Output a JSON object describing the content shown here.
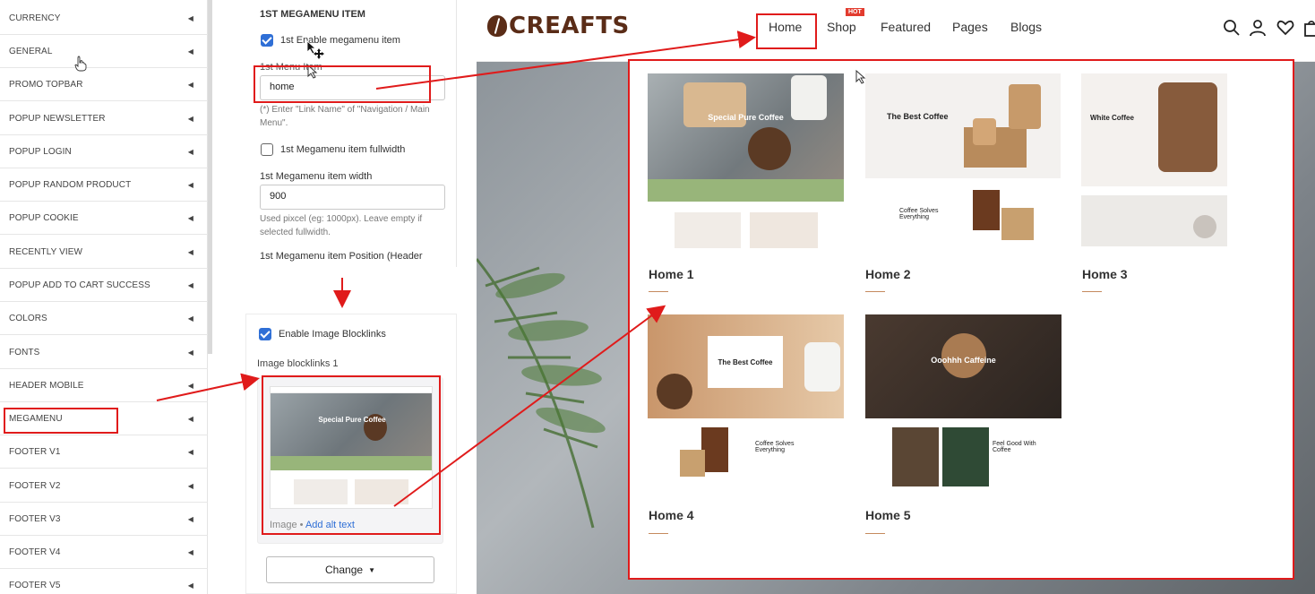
{
  "sidebar": {
    "items": [
      {
        "label": "CURRENCY"
      },
      {
        "label": "GENERAL"
      },
      {
        "label": "PROMO TOPBAR"
      },
      {
        "label": "POPUP NEWSLETTER"
      },
      {
        "label": "POPUP LOGIN"
      },
      {
        "label": "POPUP RANDOM PRODUCT"
      },
      {
        "label": "POPUP COOKIE"
      },
      {
        "label": "RECENTLY VIEW"
      },
      {
        "label": "POPUP ADD TO CART SUCCESS"
      },
      {
        "label": "COLORS"
      },
      {
        "label": "FONTS"
      },
      {
        "label": "HEADER MOBILE"
      },
      {
        "label": "MEGAMENU"
      },
      {
        "label": "FOOTER V1"
      },
      {
        "label": "FOOTER V2"
      },
      {
        "label": "FOOTER V3"
      },
      {
        "label": "FOOTER V4"
      },
      {
        "label": "FOOTER V5"
      }
    ]
  },
  "settings": {
    "heading": "1ST MEGAMENU ITEM",
    "enable_label": "1st Enable megamenu item",
    "menu_item_label": "1st Menu Item",
    "menu_item_value": "home",
    "menu_item_help": "(*) Enter \"Link Name\" of \"Navigation / Main Menu\".",
    "fullwidth_label": "1st Megamenu item fullwidth",
    "width_label": "1st Megamenu item width",
    "width_value": "900",
    "width_help": "Used pixcel (eg: 1000px). Leave empty if selected fullwidth.",
    "position_label": "1st Megamenu item Position (Header"
  },
  "blocklinks": {
    "enable_label": "Enable Image Blocklinks",
    "image_label": "Image blocklinks 1",
    "image_caption": "Image",
    "alt_link": "Add alt text",
    "change_label": "Change",
    "thumb_hero_text": "Special Pure Coffee"
  },
  "store": {
    "logo_text": "CREAFTS",
    "nav": {
      "home": "Home",
      "shop": "Shop",
      "featured": "Featured",
      "pages": "Pages",
      "blogs": "Blogs"
    },
    "hot_badge": "HOT",
    "icons": [
      "search-icon",
      "user-icon",
      "heart-icon",
      "cart-icon"
    ],
    "megamenu": {
      "items": [
        {
          "title": "Home 1",
          "hero": "Special Pure Coffee"
        },
        {
          "title": "Home 2",
          "hero": "The Best Coffee",
          "sub": "Coffee Solves Everything"
        },
        {
          "title": "Home 3",
          "hero": "White Coffee"
        },
        {
          "title": "Home 4",
          "hero": "The Best Coffee",
          "sub": "Coffee Solves Everything"
        },
        {
          "title": "Home 5",
          "hero": "Ooohhh Caffeine",
          "sub": "Feel Good With Coffee"
        }
      ]
    }
  },
  "colors": {
    "annotation": "#e01b1b",
    "checkbox": "#2f6fd6",
    "brand": "#5a2c17",
    "link": "#2f6fd6"
  }
}
